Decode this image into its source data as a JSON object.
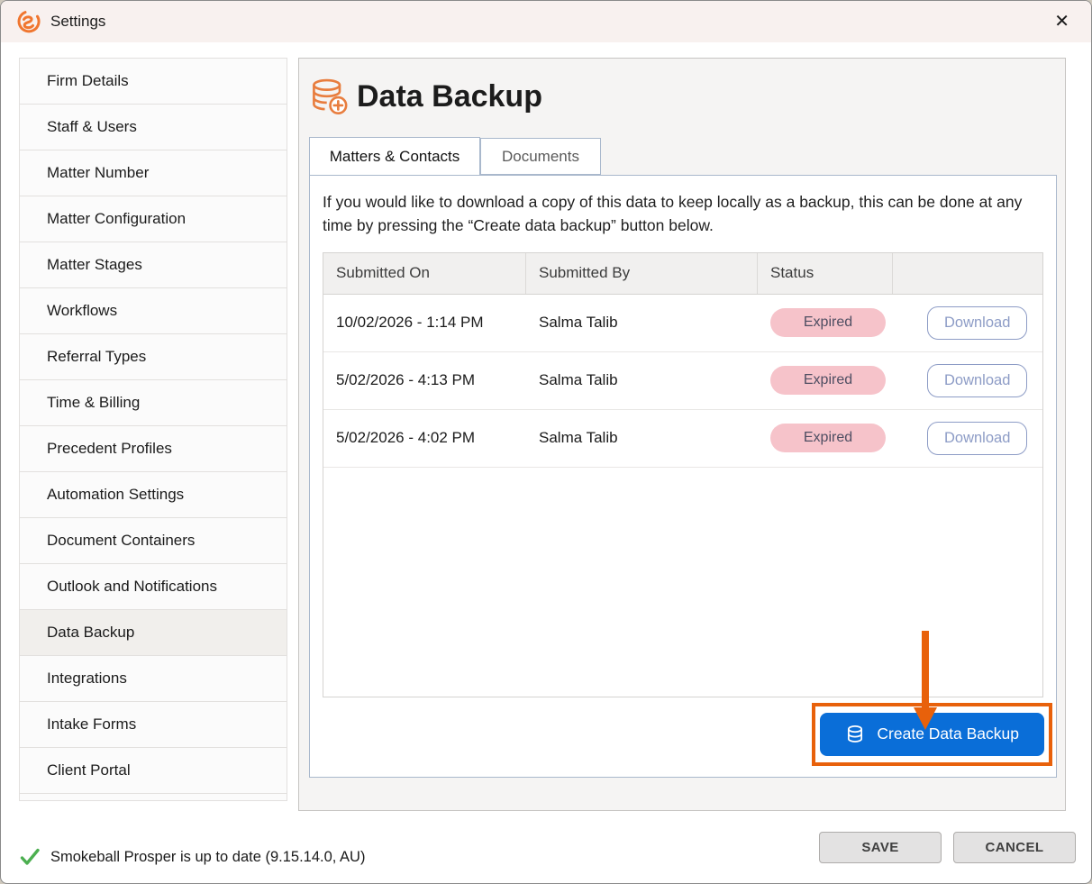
{
  "window": {
    "title": "Settings",
    "close_glyph": "✕",
    "icons": [
      "smokeball-logo-icon",
      "close-icon",
      "database-add-icon",
      "database-icon",
      "check-icon",
      "arrow-down-annotation"
    ]
  },
  "sidebar": {
    "items": [
      {
        "label": "Firm Details",
        "selected": false
      },
      {
        "label": "Staff & Users",
        "selected": false
      },
      {
        "label": "Matter Number",
        "selected": false
      },
      {
        "label": "Matter Configuration",
        "selected": false
      },
      {
        "label": "Matter Stages",
        "selected": false
      },
      {
        "label": "Workflows",
        "selected": false
      },
      {
        "label": "Referral Types",
        "selected": false
      },
      {
        "label": "Time & Billing",
        "selected": false
      },
      {
        "label": "Precedent Profiles",
        "selected": false
      },
      {
        "label": "Automation Settings",
        "selected": false
      },
      {
        "label": "Document Containers",
        "selected": false
      },
      {
        "label": "Outlook and Notifications",
        "selected": false
      },
      {
        "label": "Data Backup",
        "selected": true
      },
      {
        "label": "Integrations",
        "selected": false
      },
      {
        "label": "Intake Forms",
        "selected": false
      },
      {
        "label": "Client Portal",
        "selected": false
      }
    ]
  },
  "main": {
    "title": "Data Backup",
    "tabs": [
      {
        "label": "Matters & Contacts",
        "active": true
      },
      {
        "label": "Documents",
        "active": false
      }
    ],
    "description": "If you would like to download a copy of this data to keep locally as a backup, this can be done at any time by pressing the “Create data backup” button below.",
    "table": {
      "columns": [
        "Submitted On",
        "Submitted By",
        "Status",
        ""
      ],
      "rows": [
        {
          "submitted_on": "10/02/2026 - 1:14 PM",
          "submitted_by": "Salma Talib",
          "status": "Expired",
          "action": "Download"
        },
        {
          "submitted_on": "5/02/2026 - 4:13 PM",
          "submitted_by": "Salma Talib",
          "status": "Expired",
          "action": "Download"
        },
        {
          "submitted_on": "5/02/2026 - 4:02 PM",
          "submitted_by": "Salma Talib",
          "status": "Expired",
          "action": "Download"
        }
      ]
    },
    "create_button_label": "Create Data Backup"
  },
  "footer": {
    "status_text": "Smokeball Prosper is up to date (9.15.14.0, AU)",
    "save_label": "SAVE",
    "cancel_label": "CANCEL"
  },
  "colors": {
    "brand_orange": "#f0762f",
    "annotation_orange": "#e8610b",
    "primary_blue": "#0a6ed8",
    "expired_pink": "#f6c3ca",
    "expired_text": "#4e4e62",
    "download_steel": "#8d9cc6",
    "status_green": "#4caf50",
    "titlebar_bg": "#f8f1ef"
  }
}
